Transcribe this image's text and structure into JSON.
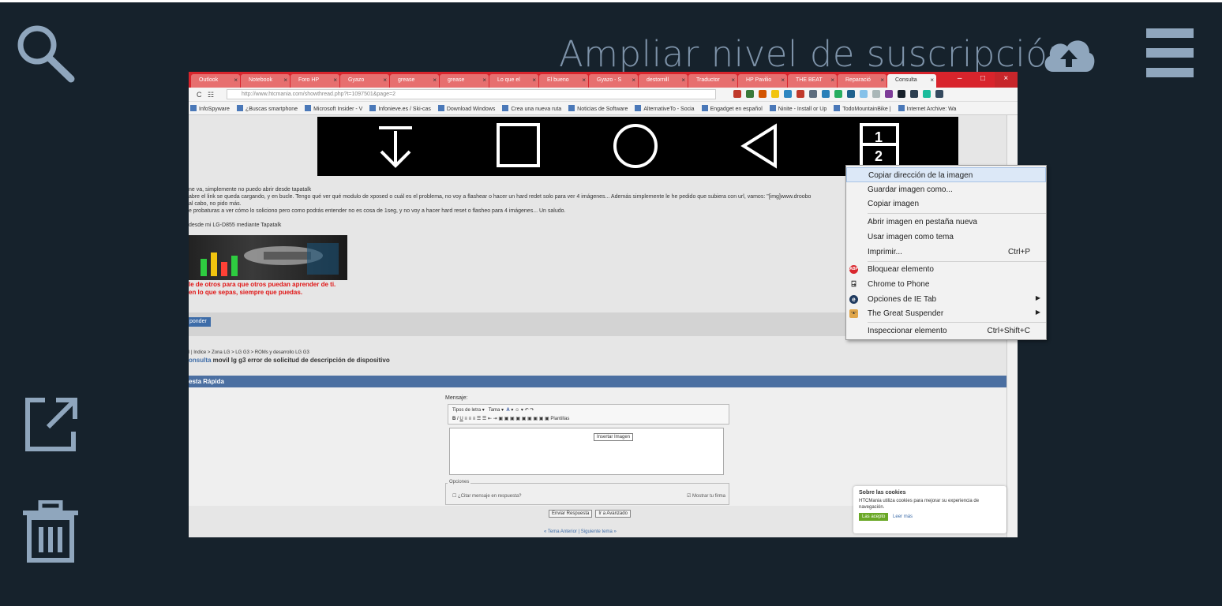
{
  "viewer": {
    "upgrade_link": "Ampliar nivel de suscripción",
    "icons": [
      "search-icon",
      "cloud-upload-icon",
      "hamburger-menu-icon",
      "open-external-icon",
      "trash-icon"
    ],
    "colors": {
      "background": "#16222c",
      "icon": "#8fa6bd"
    }
  },
  "screenshot": {
    "tabs": [
      "Outlook",
      "Notebook",
      "Foro HP",
      "Gyazo",
      "grease",
      "grease",
      "Lo que el",
      "El bueno",
      "Gyazo - S",
      "destornill",
      "Traductor",
      "HP Pavilio",
      "THE BEAT",
      "Reparació",
      "Consulta"
    ],
    "url": "http://www.htcmania.com/showthread.php?t=1097501&page=2",
    "url_bold_part": "htcmania.com",
    "bookmarks": [
      "InfoSpyware",
      "¿Buscas smartphone",
      "Microsoft Insider - V",
      "Infonieve.es / Ski-cas",
      "Download Windows",
      "Crea una nueva ruta",
      "Noticias de Software",
      "AlternativeTo - Socia",
      "Engadget en español",
      "Ninite - Install or Up",
      "TodoMountainBike |",
      "Internet Archive: Wa"
    ],
    "post_lines": [
      "ne va, simplemente no puedo abrir desde tapatalk",
      "abre el link se queda cargando, y en bucle. Tengo qué ver qué modulo de xposed o cuál es el problema, no voy a flashear o hacer un hard redet solo para ver 4 imágenes... Además simplemente le he pedido que subiera con url, vamos: \"[img]www.droobo",
      "al cabo, no pido más.",
      "e probaturas a ver cómo lo soliciono pero como podrás entender no es cosa de 1seg, y no voy a hacer hard reset o flasheo para 4 imágenes... Un saludo.",
      "",
      "desde mi LG-D855 mediante Tapatalk"
    ],
    "signature_lines": [
      "le de otros para que otros puedan aprender de ti.",
      "en lo que sepas, siempre que puedas."
    ],
    "reply_button": "ponder",
    "breadcrumb": "l | Indice > Zona LG > LG G3 > ROMs y desarrollo LG G3",
    "thread_prefix": "onsulta",
    "thread_title": " movil lg g3 error de solicitud de descripción de dispositivo",
    "quick_reply_header": "esta Rápida",
    "editor_label": "Mensaje:",
    "font_select": "Tipos de letra",
    "size_select": "Tama",
    "templates_select": "Plantillas",
    "tooltip": "Insertar Imagen",
    "options_legend": "Opciones",
    "quote_option": "¿Citar mensaje en respuesta?",
    "signature_option": "Mostrar tu firma",
    "submit_button": "Enviar Respuesta",
    "advanced_button": "Ir a Avanzado",
    "thread_nav": "« Tema Anterior | Siguiente tema »",
    "cookie": {
      "title": "Sobre las cookies",
      "text": "HTCMania utiliza cookies para mejorar su experiencia de navegación.",
      "accept": "Las acepto",
      "more": "Leer más"
    },
    "context_menu": [
      {
        "label": "Copiar dirección de la imagen",
        "highlighted": true
      },
      {
        "label": "Guardar imagen como..."
      },
      {
        "label": "Copiar imagen"
      },
      {
        "label": "Abrir imagen en pestaña nueva"
      },
      {
        "label": "Usar imagen como tema"
      },
      {
        "label": "Imprimir...",
        "shortcut": "Ctrl+P"
      },
      {
        "label": "Bloquear elemento",
        "icon": "adblock-icon"
      },
      {
        "label": "Chrome to Phone",
        "icon": "phone-icon"
      },
      {
        "label": "Opciones de IE Tab",
        "icon": "ie-tab-icon",
        "submenu": true
      },
      {
        "label": "The Great Suspender",
        "icon": "suspender-icon",
        "submenu": true
      },
      {
        "label": "Inspeccionar elemento",
        "shortcut": "Ctrl+Shift+C"
      }
    ],
    "android_nav_numbers": [
      "1",
      "2"
    ]
  }
}
